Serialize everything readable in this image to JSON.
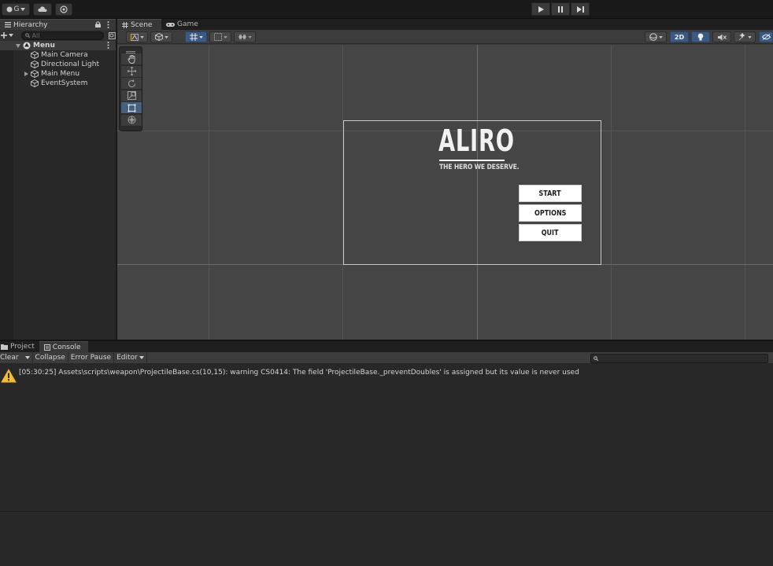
{
  "toolbar": {
    "account_label": "G",
    "play_controls": [
      "play-icon",
      "pause-icon",
      "step-icon"
    ]
  },
  "hierarchy": {
    "tab_label": "Hierarchy",
    "search_placeholder": "All",
    "scene_name": "Menu",
    "items": [
      {
        "label": "Main Camera",
        "expandable": false
      },
      {
        "label": "Directional Light",
        "expandable": false
      },
      {
        "label": "Main Menu",
        "expandable": true
      },
      {
        "label": "EventSystem",
        "expandable": false
      }
    ]
  },
  "scene_tabs": [
    {
      "label": "Scene",
      "active": true
    },
    {
      "label": "Game",
      "active": false
    }
  ],
  "scene_toolbar": {
    "mode_2d_label": "2D"
  },
  "game_ui": {
    "title": "ALIRO",
    "tagline": "THE HERO WE DESERVE.",
    "buttons": [
      "START",
      "OPTIONS",
      "QUIT"
    ]
  },
  "console": {
    "tabs": [
      {
        "label": "Project",
        "active": false
      },
      {
        "label": "Console",
        "active": true
      }
    ],
    "clear_label": "Clear",
    "collapse_label": "Collapse",
    "error_pause_label": "Error Pause",
    "editor_label": "Editor",
    "logs": [
      {
        "type": "warning",
        "text": "[05:30:25] Assets\\scripts\\weapon\\ProjectileBase.cs(10,15): warning CS0414: The field 'ProjectileBase._preventDoubles' is assigned but its value is never used"
      }
    ]
  },
  "colors": {
    "accent_blue": "#3a5a83",
    "warning_yellow": "#f2c037",
    "scene_bg": "#454545",
    "panel_bg": "#282828"
  }
}
